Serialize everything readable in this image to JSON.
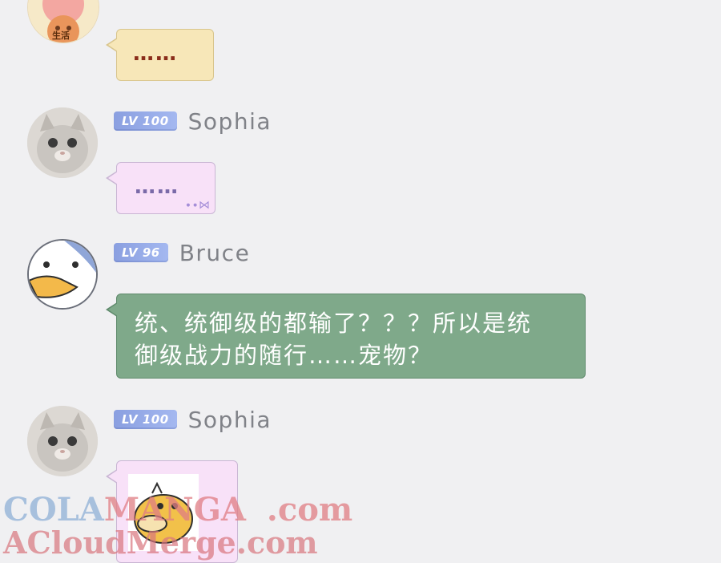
{
  "messages": [
    {
      "level": "",
      "name": "",
      "text": "……",
      "avatar_badge": "生活"
    },
    {
      "level": "LV 100",
      "name": "Sophia",
      "text": "……"
    },
    {
      "level": "LV 96",
      "name": "Bruce",
      "text": "统、统御级的都输了？？？所以是统\n御级战力的随行……宠物？"
    },
    {
      "level": "LV 100",
      "name": "Sophia",
      "text": ""
    }
  ],
  "watermark": {
    "line1_part1": "COLA",
    "line1_part2": "MANGA",
    "line1_part3": ".com",
    "line2": "ACloudMerge.com"
  },
  "colors": {
    "page_bg": "#f0f0f2",
    "yellow_bubble": "#f7e7b8",
    "pink_bubble": "#f8e1f8",
    "green_bubble": "#7fa98a",
    "level_badge": "#9aaee8"
  }
}
